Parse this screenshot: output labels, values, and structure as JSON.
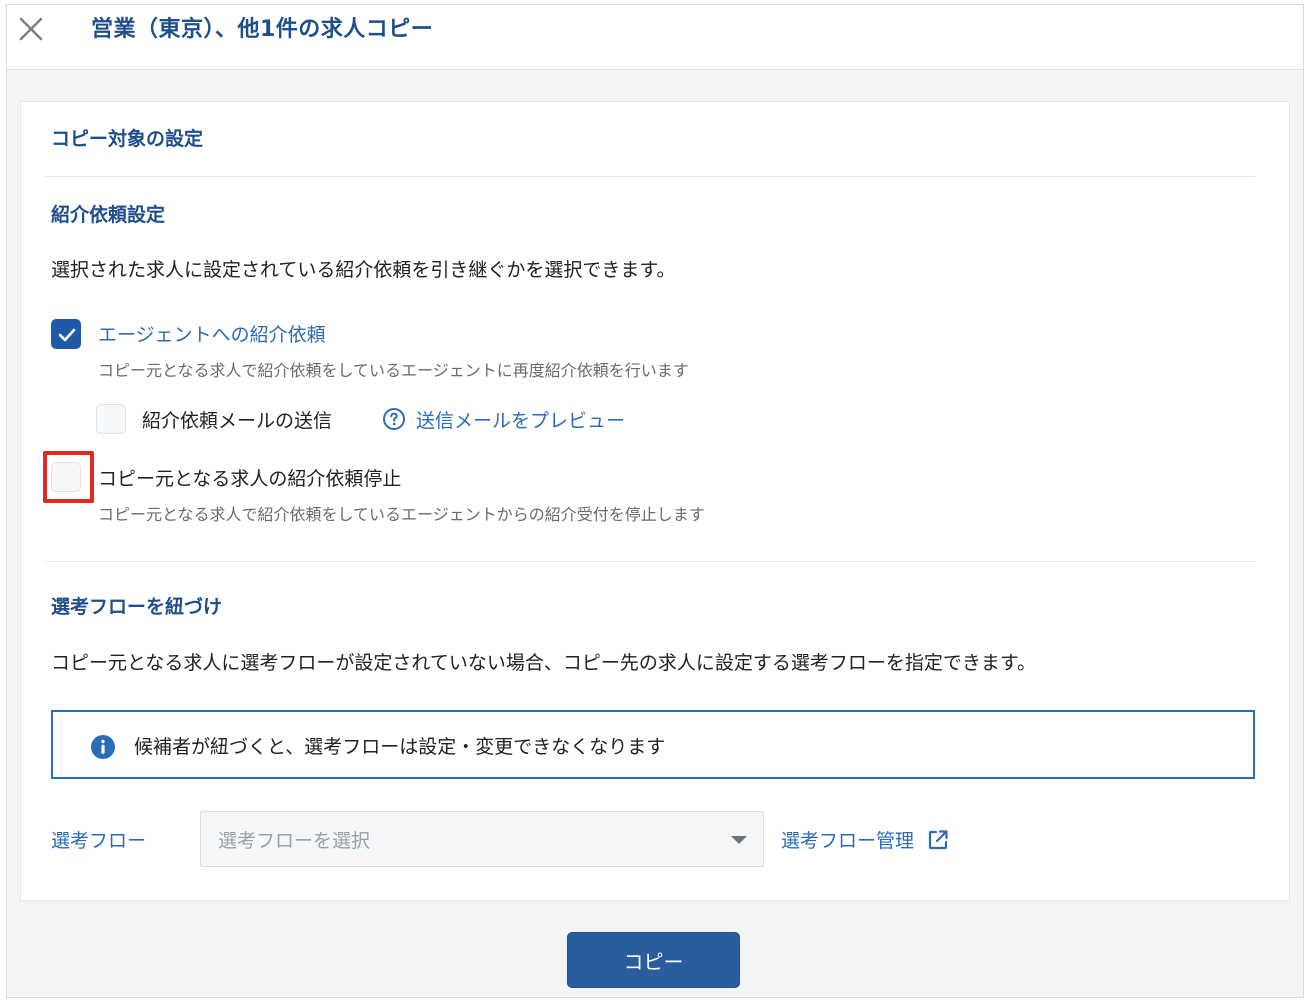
{
  "header": {
    "title": "営業（東京）、他1件の求人コピー",
    "close_icon": "close-icon"
  },
  "card": {
    "title": "コピー対象の設定"
  },
  "referral": {
    "section_title": "紹介依頼設定",
    "description": "選択された求人に設定されている紹介依頼を引き継ぐかを選択できます。",
    "agent_request": {
      "label": "エージェントへの紹介依頼",
      "checked": true,
      "description": "コピー元となる求人で紹介依頼をしているエージェントに再度紹介依頼を行います"
    },
    "send_mail": {
      "label": "紹介依頼メールの送信",
      "checked": false,
      "preview_label": "送信メールをプレビュー",
      "preview_icon": "help-circle-icon"
    },
    "stop_request": {
      "label": "コピー元となる求人の紹介依頼停止",
      "checked": false,
      "description": "コピー元となる求人で紹介依頼をしているエージェントからの紹介受付を停止します"
    }
  },
  "flow": {
    "section_title": "選考フローを紐づけ",
    "description": "コピー元となる求人に選考フローが設定されていない場合、コピー先の求人に設定する選考フローを指定できます。",
    "info_text": "候補者が紐づくと、選考フローは設定・変更できなくなります",
    "info_icon": "info-icon",
    "field_label": "選考フロー",
    "select_placeholder": "選考フローを選択",
    "manage_link": "選考フロー管理",
    "manage_icon": "external-link-icon"
  },
  "footer": {
    "copy_button": "コピー"
  },
  "colors": {
    "accent": "#2b6cb8",
    "title": "#1e4f8c",
    "button": "#2a5d9e",
    "highlight": "#e02a1f"
  }
}
